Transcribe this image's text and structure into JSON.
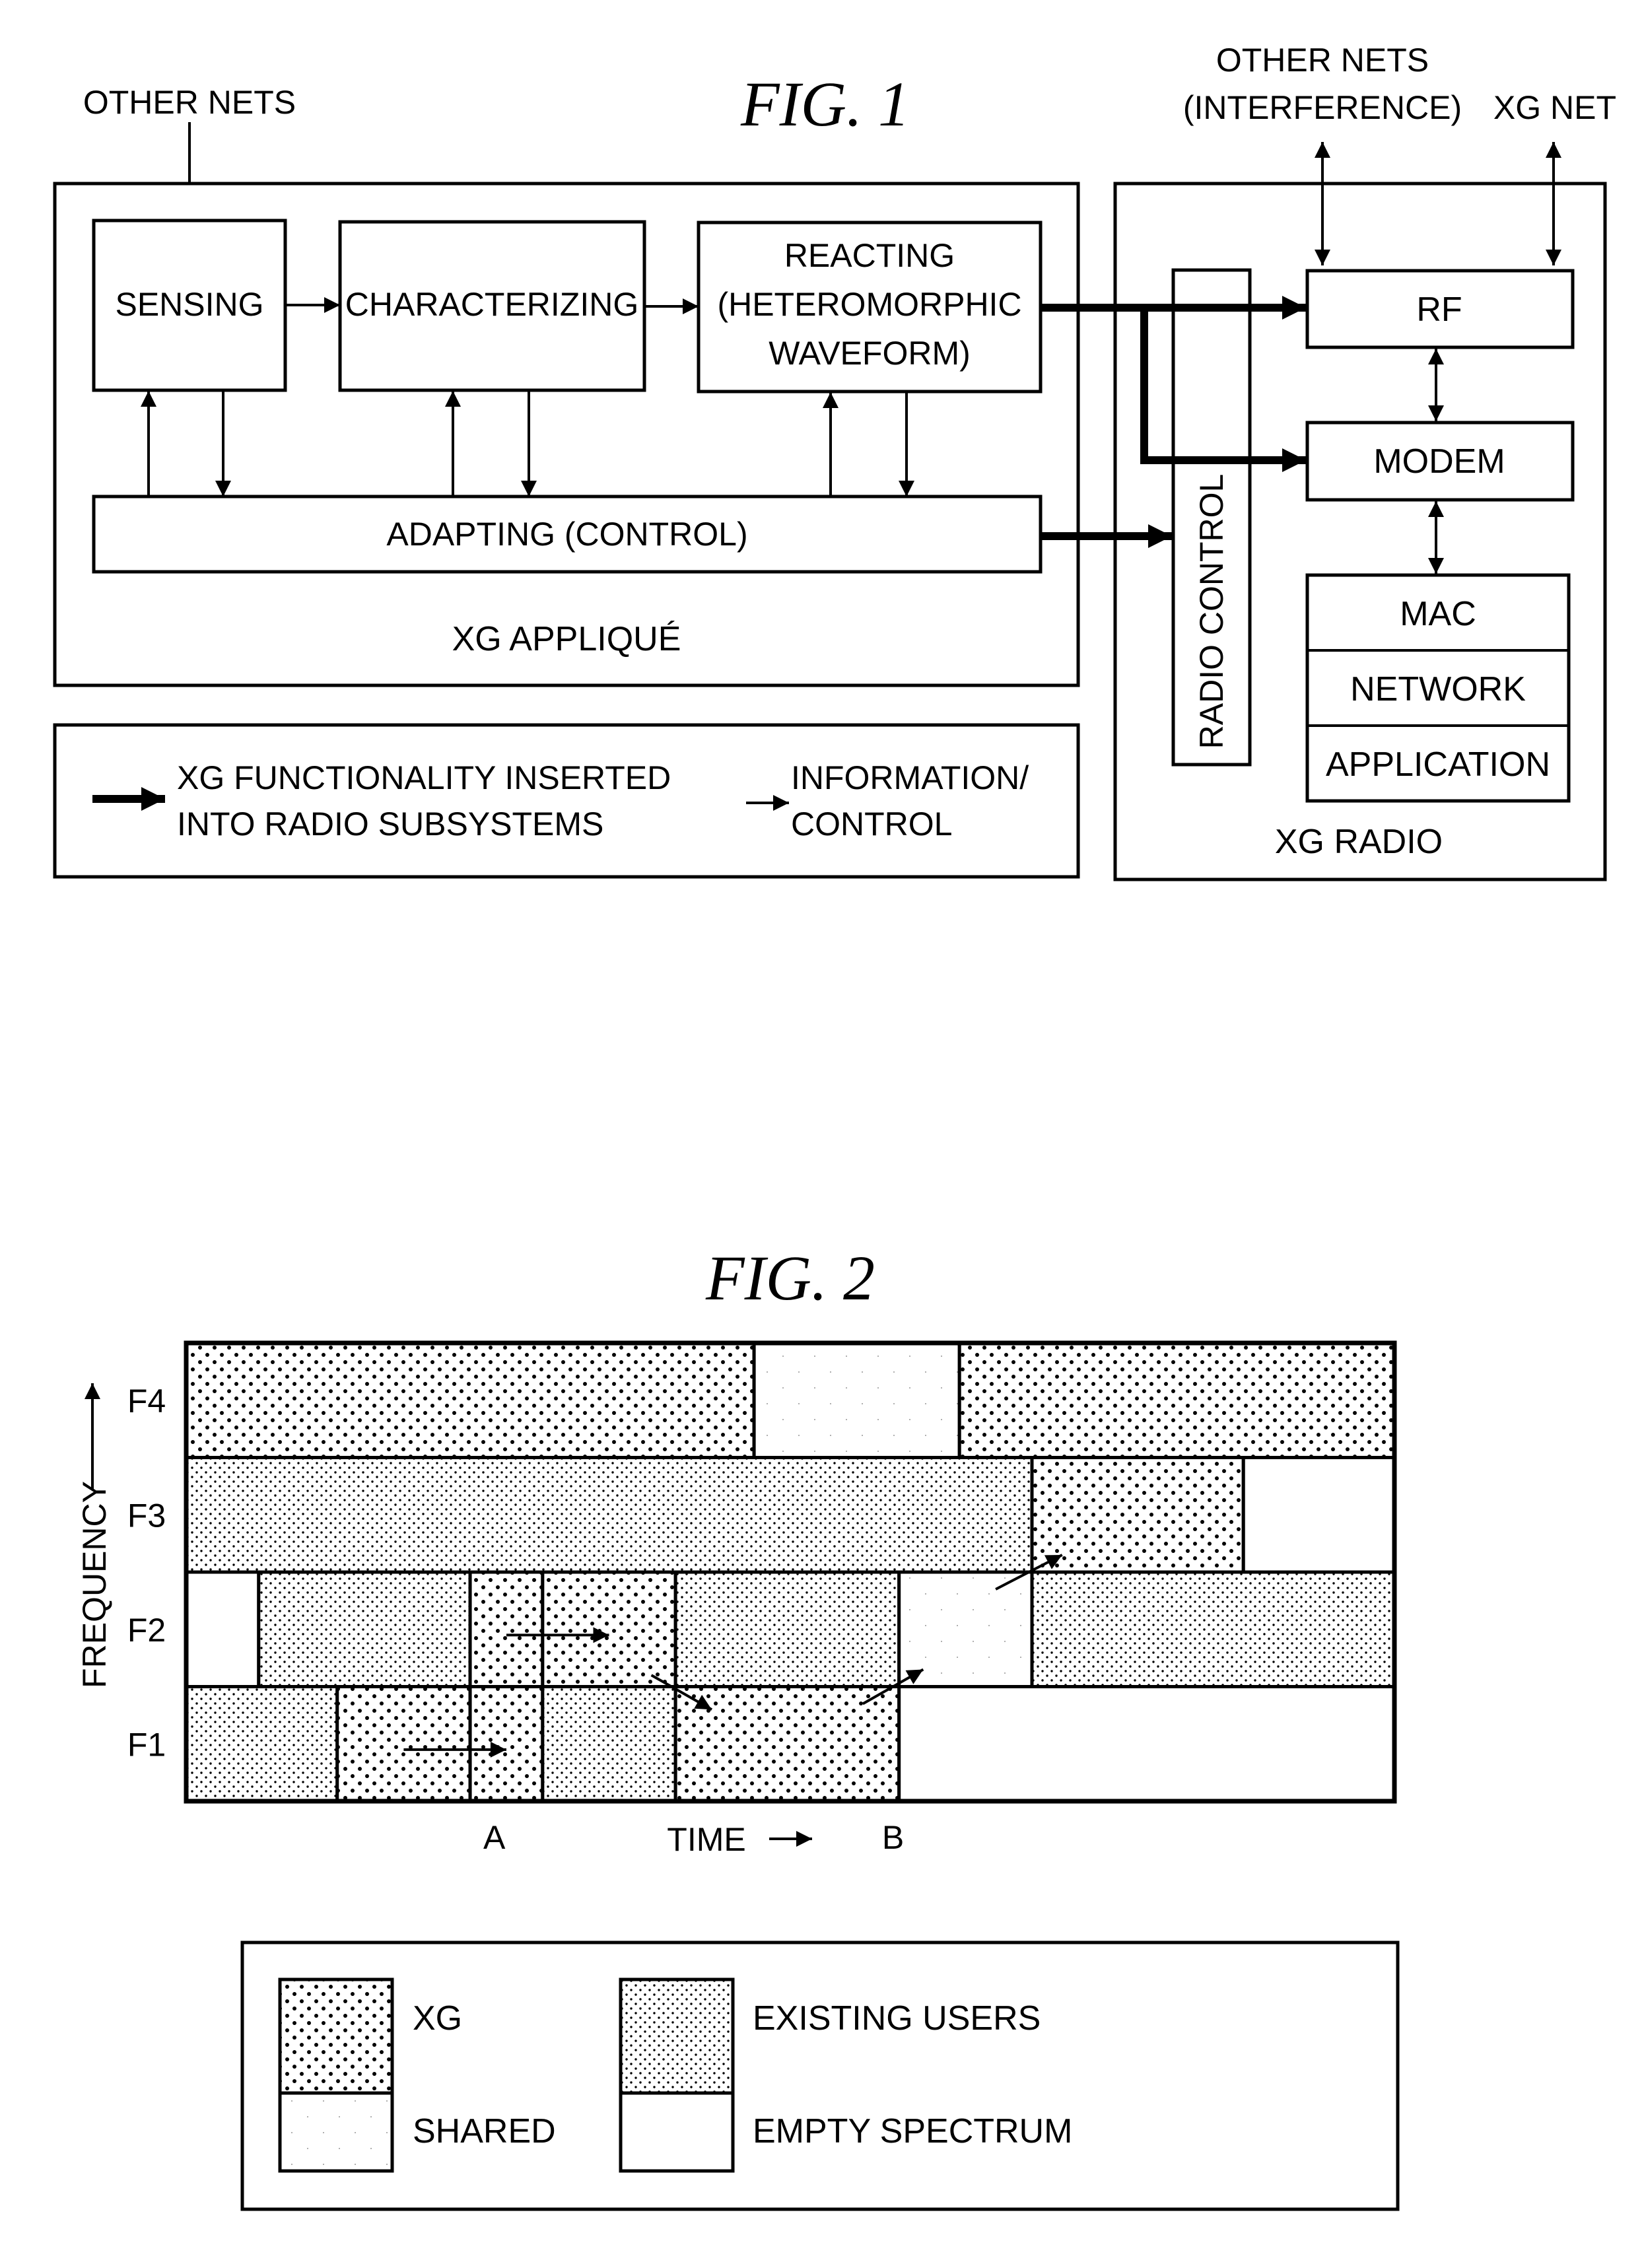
{
  "fig1": {
    "title": "FIG. 1",
    "other_nets_label": "OTHER NETS",
    "other_nets_interference_line1": "OTHER NETS",
    "other_nets_interference_line2": "(INTERFERENCE)",
    "xg_net_label": "XG NET",
    "applique": {
      "label": "XG APPLIQUÉ",
      "sensing": "SENSING",
      "characterizing": "CHARACTERIZING",
      "reacting_line1": "REACTING",
      "reacting_line2": "(HETEROMORPHIC",
      "reacting_line3": "WAVEFORM)",
      "adapting": "ADAPTING (CONTROL)"
    },
    "radio": {
      "label": "XG RADIO",
      "radio_control": "RADIO CONTROL",
      "rf": "RF",
      "modem": "MODEM",
      "stack": [
        "MAC",
        "NETWORK",
        "APPLICATION"
      ]
    },
    "legend": {
      "thick_arrow_line1": "XG FUNCTIONALITY INSERTED",
      "thick_arrow_line2": "INTO RADIO SUBSYSTEMS",
      "thin_arrow_line1": "INFORMATION/",
      "thin_arrow_line2": "CONTROL"
    }
  },
  "fig2": {
    "title": "FIG. 2",
    "y_axis_label": "FREQUENCY",
    "x_axis_label": "TIME",
    "markers": [
      "A",
      "B"
    ],
    "legend": {
      "xg": "XG",
      "existing": "EXISTING USERS",
      "shared": "SHARED",
      "empty": "EMPTY SPECTRUM"
    }
  },
  "chart_data": {
    "type": "heatmap",
    "title": "FIG. 2",
    "xlabel": "TIME",
    "ylabel": "FREQUENCY",
    "rows": [
      "F4",
      "F3",
      "F2",
      "F1"
    ],
    "time_range": [
      0,
      100
    ],
    "time_markers": [
      {
        "label": "A",
        "t": 25.5
      },
      {
        "label": "B",
        "t": 58.5
      }
    ],
    "categories": [
      "xg",
      "existing",
      "shared",
      "empty"
    ],
    "segments": {
      "F4": [
        {
          "t0": 0,
          "t1": 47,
          "type": "xg"
        },
        {
          "t0": 47,
          "t1": 64,
          "type": "shared"
        },
        {
          "t0": 64,
          "t1": 100,
          "type": "xg"
        }
      ],
      "F3": [
        {
          "t0": 0,
          "t1": 70,
          "type": "existing"
        },
        {
          "t0": 70,
          "t1": 87.5,
          "type": "xg"
        },
        {
          "t0": 87.5,
          "t1": 100,
          "type": "empty"
        }
      ],
      "F2": [
        {
          "t0": 0,
          "t1": 6,
          "type": "empty"
        },
        {
          "t0": 6,
          "t1": 23.5,
          "type": "existing"
        },
        {
          "t0": 23.5,
          "t1": 29.5,
          "type": "xg"
        },
        {
          "t0": 29.5,
          "t1": 40.5,
          "type": "xg"
        },
        {
          "t0": 40.5,
          "t1": 59,
          "type": "existing"
        },
        {
          "t0": 59,
          "t1": 70,
          "type": "shared"
        },
        {
          "t0": 70,
          "t1": 100,
          "type": "existing"
        }
      ],
      "F1": [
        {
          "t0": 0,
          "t1": 12.5,
          "type": "existing"
        },
        {
          "t0": 12.5,
          "t1": 23.5,
          "type": "xg"
        },
        {
          "t0": 23.5,
          "t1": 29.5,
          "type": "xg"
        },
        {
          "t0": 29.5,
          "t1": 40.5,
          "type": "existing"
        },
        {
          "t0": 40.5,
          "t1": 59,
          "type": "xg"
        },
        {
          "t0": 59,
          "t1": 100,
          "type": "empty"
        }
      ]
    },
    "transitions": [
      {
        "from": {
          "row": "F1",
          "t": 18
        },
        "to": {
          "row": "F1",
          "t": 26.5
        }
      },
      {
        "from": {
          "row": "F2",
          "t": 26.5
        },
        "to": {
          "row": "F2",
          "t": 35
        }
      },
      {
        "from": {
          "row": "F2",
          "t": 38.5
        },
        "to": {
          "row": "F1",
          "t": 43.5
        }
      },
      {
        "from": {
          "row": "F1",
          "t": 56
        },
        "to": {
          "row": "F2",
          "t": 61
        }
      },
      {
        "from": {
          "row": "F2",
          "t": 67
        },
        "to": {
          "row": "F3",
          "t": 72.5
        }
      }
    ],
    "grid": false,
    "legend_position": "bottom"
  }
}
